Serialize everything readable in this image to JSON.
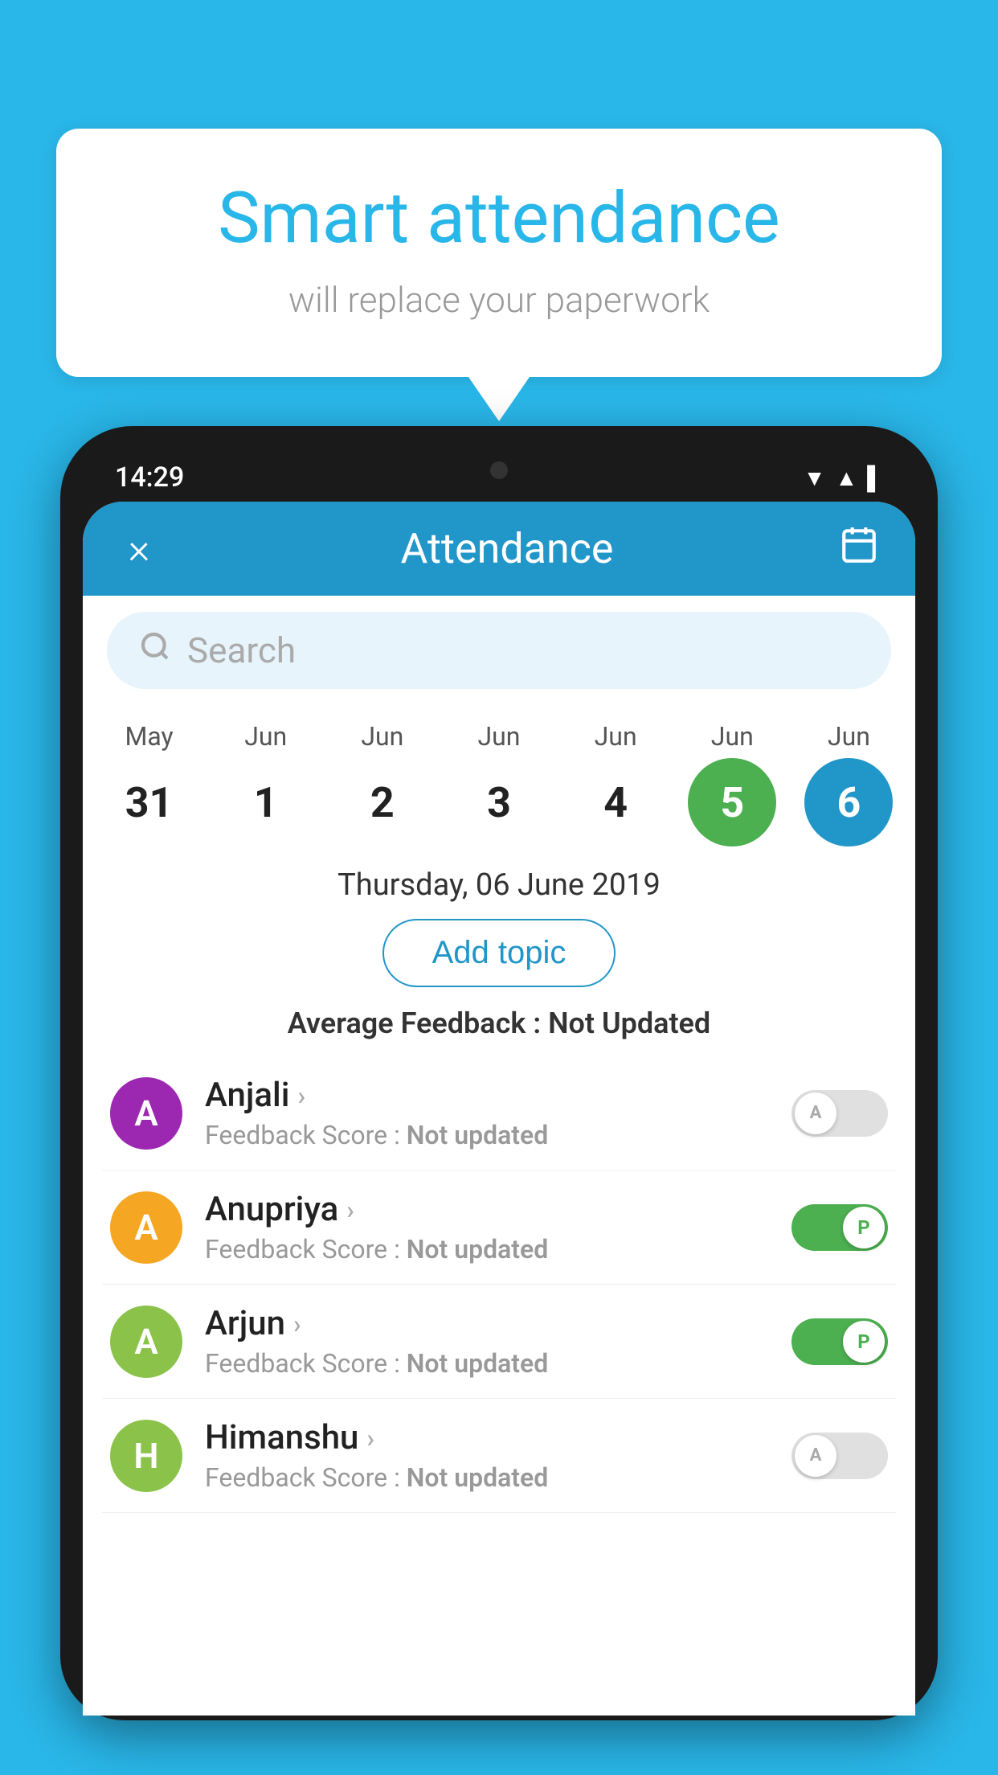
{
  "background_color": "#29b6e8",
  "speech_bubble": {
    "title": "Smart attendance",
    "subtitle": "will replace your paperwork"
  },
  "phone": {
    "status_time": "14:29",
    "header": {
      "title": "Attendance",
      "close_label": "×",
      "calendar_icon": "📅"
    },
    "search": {
      "placeholder": "Search"
    },
    "dates": [
      {
        "month": "May",
        "day": "31",
        "style": "normal"
      },
      {
        "month": "Jun",
        "day": "1",
        "style": "normal"
      },
      {
        "month": "Jun",
        "day": "2",
        "style": "normal"
      },
      {
        "month": "Jun",
        "day": "3",
        "style": "normal"
      },
      {
        "month": "Jun",
        "day": "4",
        "style": "normal"
      },
      {
        "month": "Jun",
        "day": "5",
        "style": "green"
      },
      {
        "month": "Jun",
        "day": "6",
        "style": "blue"
      }
    ],
    "selected_date": "Thursday, 06 June 2019",
    "add_topic_label": "Add topic",
    "avg_feedback_label": "Average Feedback :",
    "avg_feedback_value": "Not Updated",
    "students": [
      {
        "name": "Anjali",
        "avatar_letter": "A",
        "avatar_color": "#9c27b0",
        "feedback_label": "Feedback Score :",
        "feedback_value": "Not updated",
        "status": "absent"
      },
      {
        "name": "Anupriya",
        "avatar_letter": "A",
        "avatar_color": "#f5a623",
        "feedback_label": "Feedback Score :",
        "feedback_value": "Not updated",
        "status": "present"
      },
      {
        "name": "Arjun",
        "avatar_letter": "A",
        "avatar_color": "#8bc34a",
        "feedback_label": "Feedback Score :",
        "feedback_value": "Not updated",
        "status": "present"
      },
      {
        "name": "Himanshu",
        "avatar_letter": "H",
        "avatar_color": "#8bc34a",
        "feedback_label": "Feedback Score :",
        "feedback_value": "Not updated",
        "status": "absent"
      }
    ]
  }
}
